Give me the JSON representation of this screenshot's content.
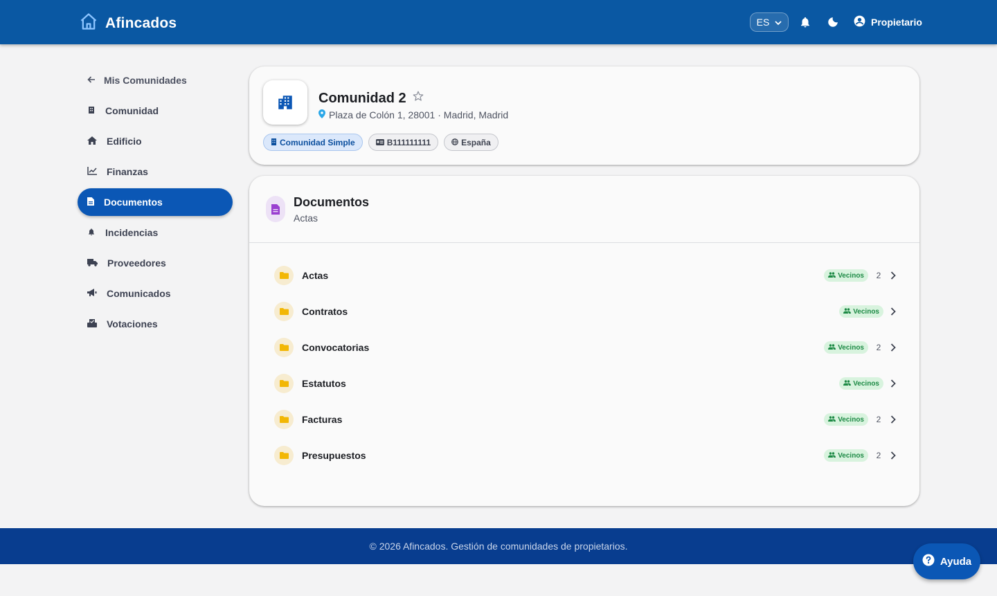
{
  "header": {
    "app_name": "Afincados",
    "language": "ES",
    "user_label": "Propietario",
    "brand_color": "#0a58a3"
  },
  "sidebar": {
    "back_label": "Mis Comunidades",
    "items": [
      {
        "label": "Comunidad",
        "icon": "building-icon"
      },
      {
        "label": "Edificio",
        "icon": "home-icon"
      },
      {
        "label": "Finanzas",
        "icon": "chart-icon"
      },
      {
        "label": "Documentos",
        "icon": "document-icon",
        "active": true
      },
      {
        "label": "Incidencias",
        "icon": "bell-icon"
      },
      {
        "label": "Proveedores",
        "icon": "truck-icon"
      },
      {
        "label": "Comunicados",
        "icon": "megaphone-icon"
      },
      {
        "label": "Votaciones",
        "icon": "ballot-icon"
      }
    ]
  },
  "community": {
    "name": "Comunidad 2",
    "address": "Plaza de Colón 1, 28001 · Madrid, Madrid",
    "chips": {
      "type": "Comunidad Simple",
      "cif": "B111111111",
      "country": "España"
    }
  },
  "documents": {
    "title": "Documentos",
    "subtitle": "Actas",
    "folders": [
      {
        "name": "Actas",
        "visibility": "Vecinos",
        "count": "2"
      },
      {
        "name": "Contratos",
        "visibility": "Vecinos",
        "count": ""
      },
      {
        "name": "Convocatorias",
        "visibility": "Vecinos",
        "count": "2"
      },
      {
        "name": "Estatutos",
        "visibility": "Vecinos",
        "count": ""
      },
      {
        "name": "Facturas",
        "visibility": "Vecinos",
        "count": "2"
      },
      {
        "name": "Presupuestos",
        "visibility": "Vecinos",
        "count": "2"
      }
    ]
  },
  "footer": {
    "text": "© 2026 Afincados. Gestión de comunidades de propietarios."
  },
  "help_button": {
    "label": "Ayuda"
  }
}
